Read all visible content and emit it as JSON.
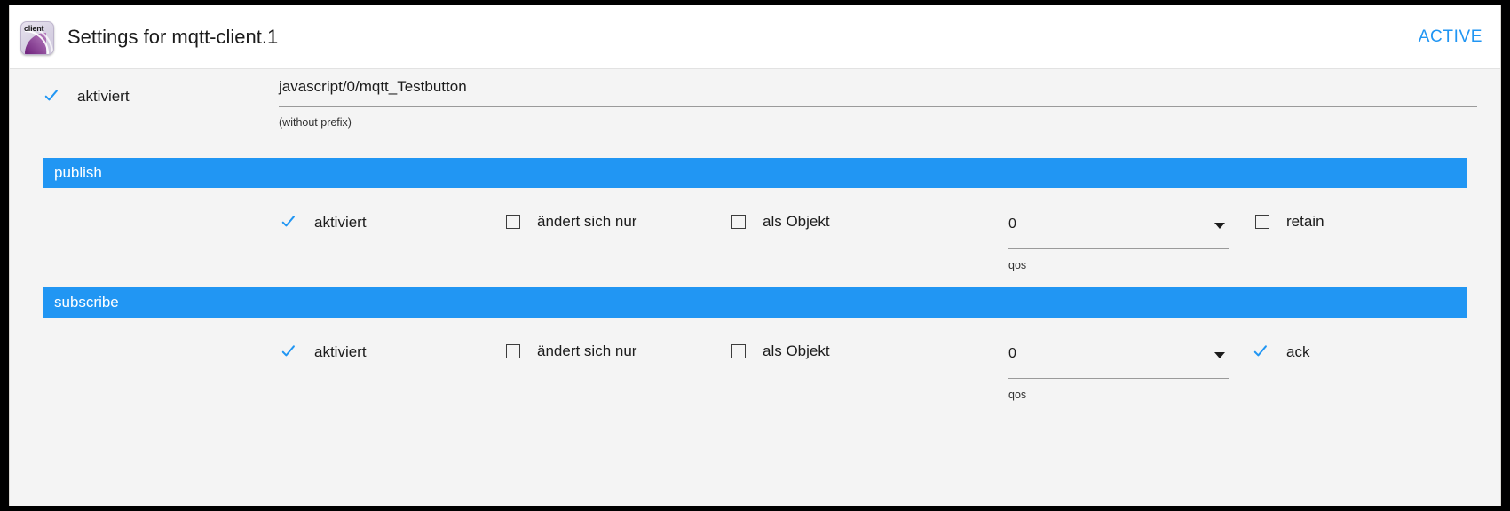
{
  "window": {
    "frame_color": "#000000",
    "background": "#f4f4f4"
  },
  "header": {
    "logo_icon": "client-logo-icon",
    "logo_word": "client",
    "title": "Settings for mqtt-client.1",
    "status": "ACTIVE",
    "status_color": "#2196f3"
  },
  "top": {
    "enabled": {
      "label": "aktiviert",
      "checked": true
    },
    "topic_field": {
      "value": "javascript/0/mqtt_Testbutton",
      "hint": "(without prefix)"
    }
  },
  "sections": [
    {
      "title": "publish",
      "accent": "#2196f3",
      "checkboxes": [
        {
          "label": "aktiviert",
          "checked": true
        },
        {
          "label": "ändert sich nur",
          "checked": false
        },
        {
          "label": "als Objekt",
          "checked": false
        }
      ],
      "select": {
        "value": "0",
        "hint": "qos",
        "caret_icon": "chevron-down-icon"
      },
      "last_checkbox": {
        "label": "retain",
        "checked": false
      }
    },
    {
      "title": "subscribe",
      "accent": "#2196f3",
      "checkboxes": [
        {
          "label": "aktiviert",
          "checked": true
        },
        {
          "label": "ändert sich nur",
          "checked": false
        },
        {
          "label": "als Objekt",
          "checked": false
        }
      ],
      "select": {
        "value": "0",
        "hint": "qos",
        "caret_icon": "chevron-down-icon"
      },
      "last_checkbox": {
        "label": "ack",
        "checked": true
      }
    }
  ]
}
